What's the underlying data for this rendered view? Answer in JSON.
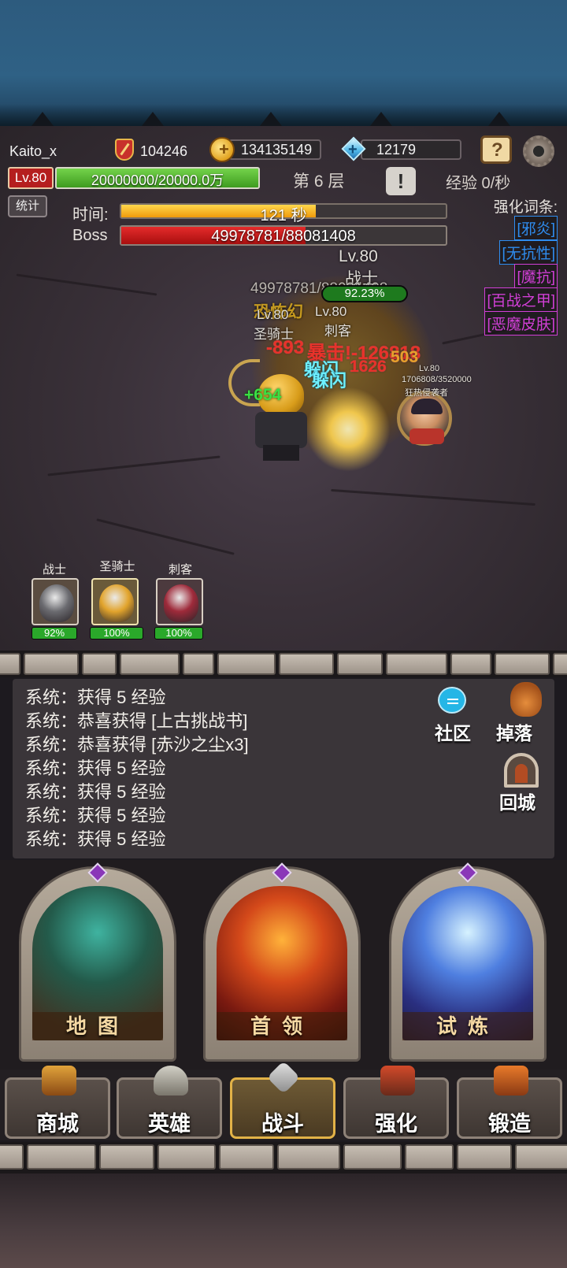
{
  "header": {
    "username": "Kaito_x",
    "attack": "104246",
    "gold": "134135149",
    "gems": "12179",
    "level_badge": "Lv.80",
    "xp_text": "20000000/20000.0万",
    "floor": "第 6 层",
    "exp_rate": "经验 0/秒",
    "stats_button": "统计"
  },
  "timer": {
    "label": "时间:",
    "text": "121 秒",
    "progress": 0.6
  },
  "boss": {
    "label": "Boss",
    "hp_text": "49978781/88081408",
    "progress": 0.567
  },
  "affixes": {
    "title": "强化词条:",
    "items": [
      {
        "text": "[邪炎]",
        "color": "#2f8df0"
      },
      {
        "text": "[无抗性]",
        "color": "#2f8df0"
      },
      {
        "text": "[魔抗]",
        "color": "#d13fd6"
      },
      {
        "text": "[百战之甲]",
        "color": "#d13fd6"
      },
      {
        "text": "[恶魔皮肤]",
        "color": "#d13fd6"
      }
    ]
  },
  "battle": {
    "boss_level": "Lv.80",
    "boss_role": "战士",
    "boss_hp_partial": "49978781/88081408",
    "hero_hp_pill": "92.23%",
    "boss_title": "恐怖幻",
    "hero1_level": "Lv.80",
    "hero1_name": "圣骑士",
    "hero2_level": "Lv.80",
    "hero2_name": "刺客",
    "enemy_level": "Lv.80",
    "enemy_hp": "1706808/3520000",
    "enemy_name": "狂热侵袭者",
    "dmg1": "-893",
    "crit": "暴击!-126818",
    "dmg2": "503",
    "dodge1": "躲闪",
    "dodge2": "躲闪",
    "dmg3": "1626",
    "heal": "+654"
  },
  "party": [
    {
      "name": "战士",
      "hp": "92%",
      "color": "#6b6b70"
    },
    {
      "name": "圣骑士",
      "hp": "100%",
      "color": "#e2a42c"
    },
    {
      "name": "刺客",
      "hp": "100%",
      "color": "#9e2a3a"
    }
  ],
  "log": [
    "系统：获得 5 经验",
    "系统：恭喜获得 [上古挑战书]",
    "系统：恭喜获得 [赤沙之尘x3]",
    "系统：获得 5 经验",
    "系统：获得 5 经验",
    "系统：获得 5 经验",
    "系统：获得 5 经验"
  ],
  "side": {
    "community": "社区",
    "loot": "掉落",
    "town": "回城"
  },
  "modes": [
    {
      "label": "地图"
    },
    {
      "label": "首领"
    },
    {
      "label": "试炼"
    }
  ],
  "nav": [
    {
      "label": "商城",
      "icon": "treasure-chest-icon"
    },
    {
      "label": "英雄",
      "icon": "viking-helmet-icon"
    },
    {
      "label": "战斗",
      "icon": "crossed-swords-icon",
      "active": true
    },
    {
      "label": "强化",
      "icon": "hammer-icon"
    },
    {
      "label": "锻造",
      "icon": "anvil-icon"
    }
  ]
}
